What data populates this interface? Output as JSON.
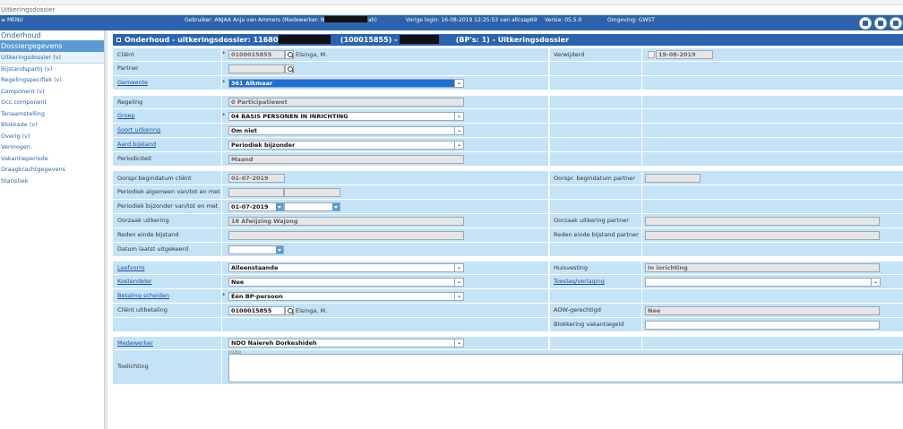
{
  "window": {
    "breadcrumb": "Uitkeringsdossier"
  },
  "topbar": {
    "menu": "MENU",
    "user": "Gebruiker: ANJAA Anja van Ammers (Medewerker: NDO N",
    "user_tail": "ah)",
    "last_login": "Vorige login: 16-08-2019 12:25:53 van allcsap69",
    "version": "Versie: 05.5.0",
    "environment": "Omgeving: GWST"
  },
  "sidebar": {
    "items": [
      {
        "label": "Onderhoud",
        "type": "main"
      },
      {
        "label": "Dossiergegevens",
        "type": "main-active"
      },
      {
        "label": "Uitkeringsdossier (v)",
        "type": "sub"
      },
      {
        "label": "Bijstandspartij (v)",
        "type": "sub"
      },
      {
        "label": "Regelingspecifiek (v)",
        "type": "sub"
      },
      {
        "label": "Component (v)",
        "type": "sub"
      },
      {
        "label": "Occ.component",
        "type": "sub"
      },
      {
        "label": "Tenaamstelling",
        "type": "sub"
      },
      {
        "label": "Blokkade (v)",
        "type": "sub"
      },
      {
        "label": "Overig (v)",
        "type": "sub"
      },
      {
        "label": "Vermogen",
        "type": "sub"
      },
      {
        "label": "Vakantieperiode",
        "type": "sub"
      },
      {
        "label": "Draagkrachtgegevens",
        "type": "sub"
      },
      {
        "label": "Statistiek",
        "type": "sub"
      }
    ]
  },
  "panel": {
    "title_a": "Onderhoud - uitkeringsdossier: 116800 - ",
    "title_b": "(100015855) - BSN",
    "title_c": "(BP's: 1) - Uitkeringsdossier"
  },
  "form": {
    "client": {
      "label": "Cliënt",
      "value": "0100015855",
      "name": "Elsinga, M."
    },
    "partner": {
      "label": "Partner",
      "value": ""
    },
    "gemeente": {
      "label": "Gemeente",
      "value": "361 Alkmaar"
    },
    "verwijderd": {
      "label": "Verwijderd",
      "value": "19-08-2019"
    },
    "regeling": {
      "label": "Regeling",
      "value": "0 Participatiewet"
    },
    "groep": {
      "label": "Groep",
      "value": "04 BASIS PERSONEN IN INRICHTING"
    },
    "soort_uitkering": {
      "label": "Soort uitkering",
      "value": "Om niet"
    },
    "aard_bijstand": {
      "label": "Aard bijstand",
      "value": "Periodiek bijzonder"
    },
    "periodiciteit": {
      "label": "Periodiciteit",
      "value": "Maand"
    },
    "oorspr_begindatum_client": {
      "label": "Oorspr.begindatum cliënt",
      "value": "01-07-2019"
    },
    "oorspr_begindatum_partner": {
      "label": "Oorspr. begindatum partner",
      "value": ""
    },
    "periodiek_algemeen": {
      "label": "Periodiek algemeen van/tot en met",
      "from": "",
      "to": ""
    },
    "periodiek_bijzonder": {
      "label": "Periodiek bijzonder van/tot en met",
      "from": "01-07-2019",
      "to": ""
    },
    "oorzaak_uitkering": {
      "label": "Oorzaak uitkering",
      "value": "18 Afwijzing Wajong"
    },
    "oorzaak_uitkering_partner": {
      "label": "Oorzaak uitkering partner",
      "value": ""
    },
    "reden_einde": {
      "label": "Reden einde bijstand",
      "value": ""
    },
    "reden_einde_partner": {
      "label": "Reden einde bijstand partner",
      "value": ""
    },
    "datum_laatst": {
      "label": "Datum laatst uitgekeerd",
      "value": ""
    },
    "leefvorm": {
      "label": "Leefvorm",
      "value": "Alleenstaande"
    },
    "huisvesting": {
      "label": "Huisvesting",
      "value": "In inrichting"
    },
    "kostendeler": {
      "label": "Kostendeler",
      "value": "Nee"
    },
    "toeslag": {
      "label": "Toeslag/verlaging",
      "value": ""
    },
    "betaling_scheiden": {
      "label": "Betaling scheiden",
      "value": "Één BP-persoon"
    },
    "client_uitbetaling": {
      "label": "Cliënt uitbetaling",
      "value": "0100015855",
      "name": "Elsinga, M."
    },
    "aow": {
      "label": "AOW-gerechtigd",
      "value": "Nee"
    },
    "blokkering": {
      "label": "Blokkering vakantiegeld",
      "value": ""
    },
    "medewerker": {
      "label": "Medewerker",
      "value": "NDO Naiereh Dorkeshideh"
    },
    "toelichting": {
      "label": "Toelichting",
      "value": "",
      "counter": "0/2000"
    },
    "required_marker": "*"
  },
  "colors": {
    "accent": "#2b64ad",
    "cell": "#c5e3f6",
    "select_highlight": "#1e6fd3"
  }
}
